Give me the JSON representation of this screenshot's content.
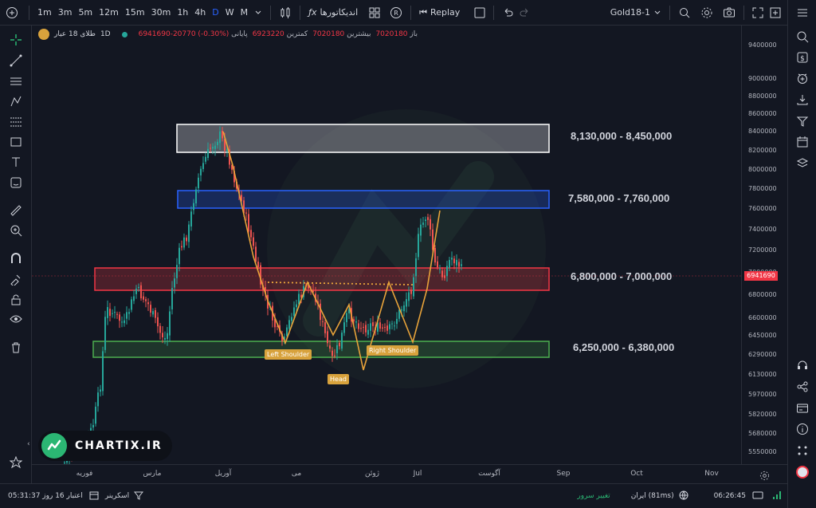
{
  "topbar": {
    "timeframes": [
      "1m",
      "3m",
      "5m",
      "12m",
      "15m",
      "30m",
      "1h",
      "4h",
      "D",
      "W",
      "M"
    ],
    "active_timeframe": "D",
    "indicators_label": "اندیکاتورها",
    "replay_label": "Replay",
    "symbol_label": "Gold18-1"
  },
  "legend": {
    "symbol": "طلای 18 عیار",
    "interval": "1D",
    "open_label": "باز",
    "open_value": "7020180",
    "high_label": "بیشترین",
    "high_value": "7020180",
    "low_label": "کمترین",
    "low_value": "6923220",
    "close_label": "پایانی",
    "close_value": "6941690-20770 (-0.30%)"
  },
  "zones": [
    {
      "label": "8,130,000 - 8,450,000",
      "color": "#ffffff"
    },
    {
      "label": "7,580,000 - 7,760,000",
      "color": "#2962ff"
    },
    {
      "label": "6,800,000 - 7,000,000",
      "color": "#f23645"
    },
    {
      "label": "6,250,000 - 6,380,000",
      "color": "#4caf50"
    }
  ],
  "pattern_labels": {
    "left": "Left Shoulder",
    "head": "Head",
    "right": "Right Shoulder"
  },
  "price_axis": [
    "9400000",
    "9000000",
    "8800000",
    "8600000",
    "8400000",
    "8200000",
    "8000000",
    "7800000",
    "7600000",
    "7400000",
    "7200000",
    "7000000",
    "6800000",
    "6600000",
    "6450000",
    "6290000",
    "6130000",
    "5970000",
    "5820000",
    "5680000",
    "5550000"
  ],
  "current_price": "6941690",
  "time_axis": [
    "فوریه",
    "مارس",
    "آوریل",
    "می",
    "ژوئن",
    "Jul",
    "آگوست",
    "Sep",
    "Oct",
    "Nov"
  ],
  "brand": {
    "name": "CHARTIX.IR",
    "color": "#2bb673"
  },
  "bottombar": {
    "date_label": "05:31:37 اعتبار 16 روز",
    "screener_label": "اسکرینر",
    "server_label": "تغییر سرور",
    "region_label": "ایران (81ms)",
    "time": "06:26:45"
  },
  "colors": {
    "up": "#26a69a",
    "down": "#ef5350",
    "pattern": "#e8a33a",
    "background": "#131722"
  },
  "icons": [
    "plus-icon",
    "crosshair-icon",
    "trendline-icon",
    "horizontal-lines-icon",
    "pitchfork-icon",
    "fib-icon",
    "rectangle-icon",
    "text-icon",
    "emoji-icon",
    "ruler-icon",
    "zoom-icon",
    "magnet-icon",
    "lock-draw-icon",
    "lock-icon",
    "eye-icon",
    "trash-icon",
    "star-icon"
  ]
}
